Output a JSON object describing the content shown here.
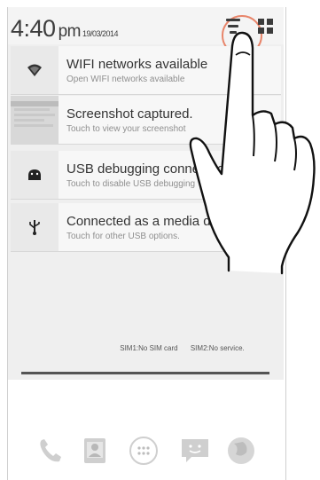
{
  "status": {
    "time": "4:40",
    "ampm": "pm",
    "date": "19/03/2014"
  },
  "notifications": [
    {
      "icon": "wifi-icon",
      "title": "WIFI networks available",
      "subtitle": "Open WIFI networks available"
    },
    {
      "icon": "screenshot-thumbnail",
      "title": "Screenshot captured.",
      "subtitle": "Touch to view your screenshot"
    },
    {
      "icon": "android-debug-icon",
      "title": "USB debugging connected",
      "subtitle": "Touch to disable USB debugging"
    },
    {
      "icon": "usb-icon",
      "title": "Connected as a media device",
      "subtitle": "Touch for other USB options."
    }
  ],
  "sim": {
    "sim1": "SIM1:No SIM card",
    "sim2": "SIM2:No service."
  },
  "dock": [
    "phone-icon",
    "contacts-icon",
    "app-drawer-icon",
    "messaging-icon",
    "browser-icon"
  ],
  "colors": {
    "touch_ring": "#e8856a",
    "shade_bg": "#efefef",
    "notification_bg": "#f7f7f7"
  }
}
